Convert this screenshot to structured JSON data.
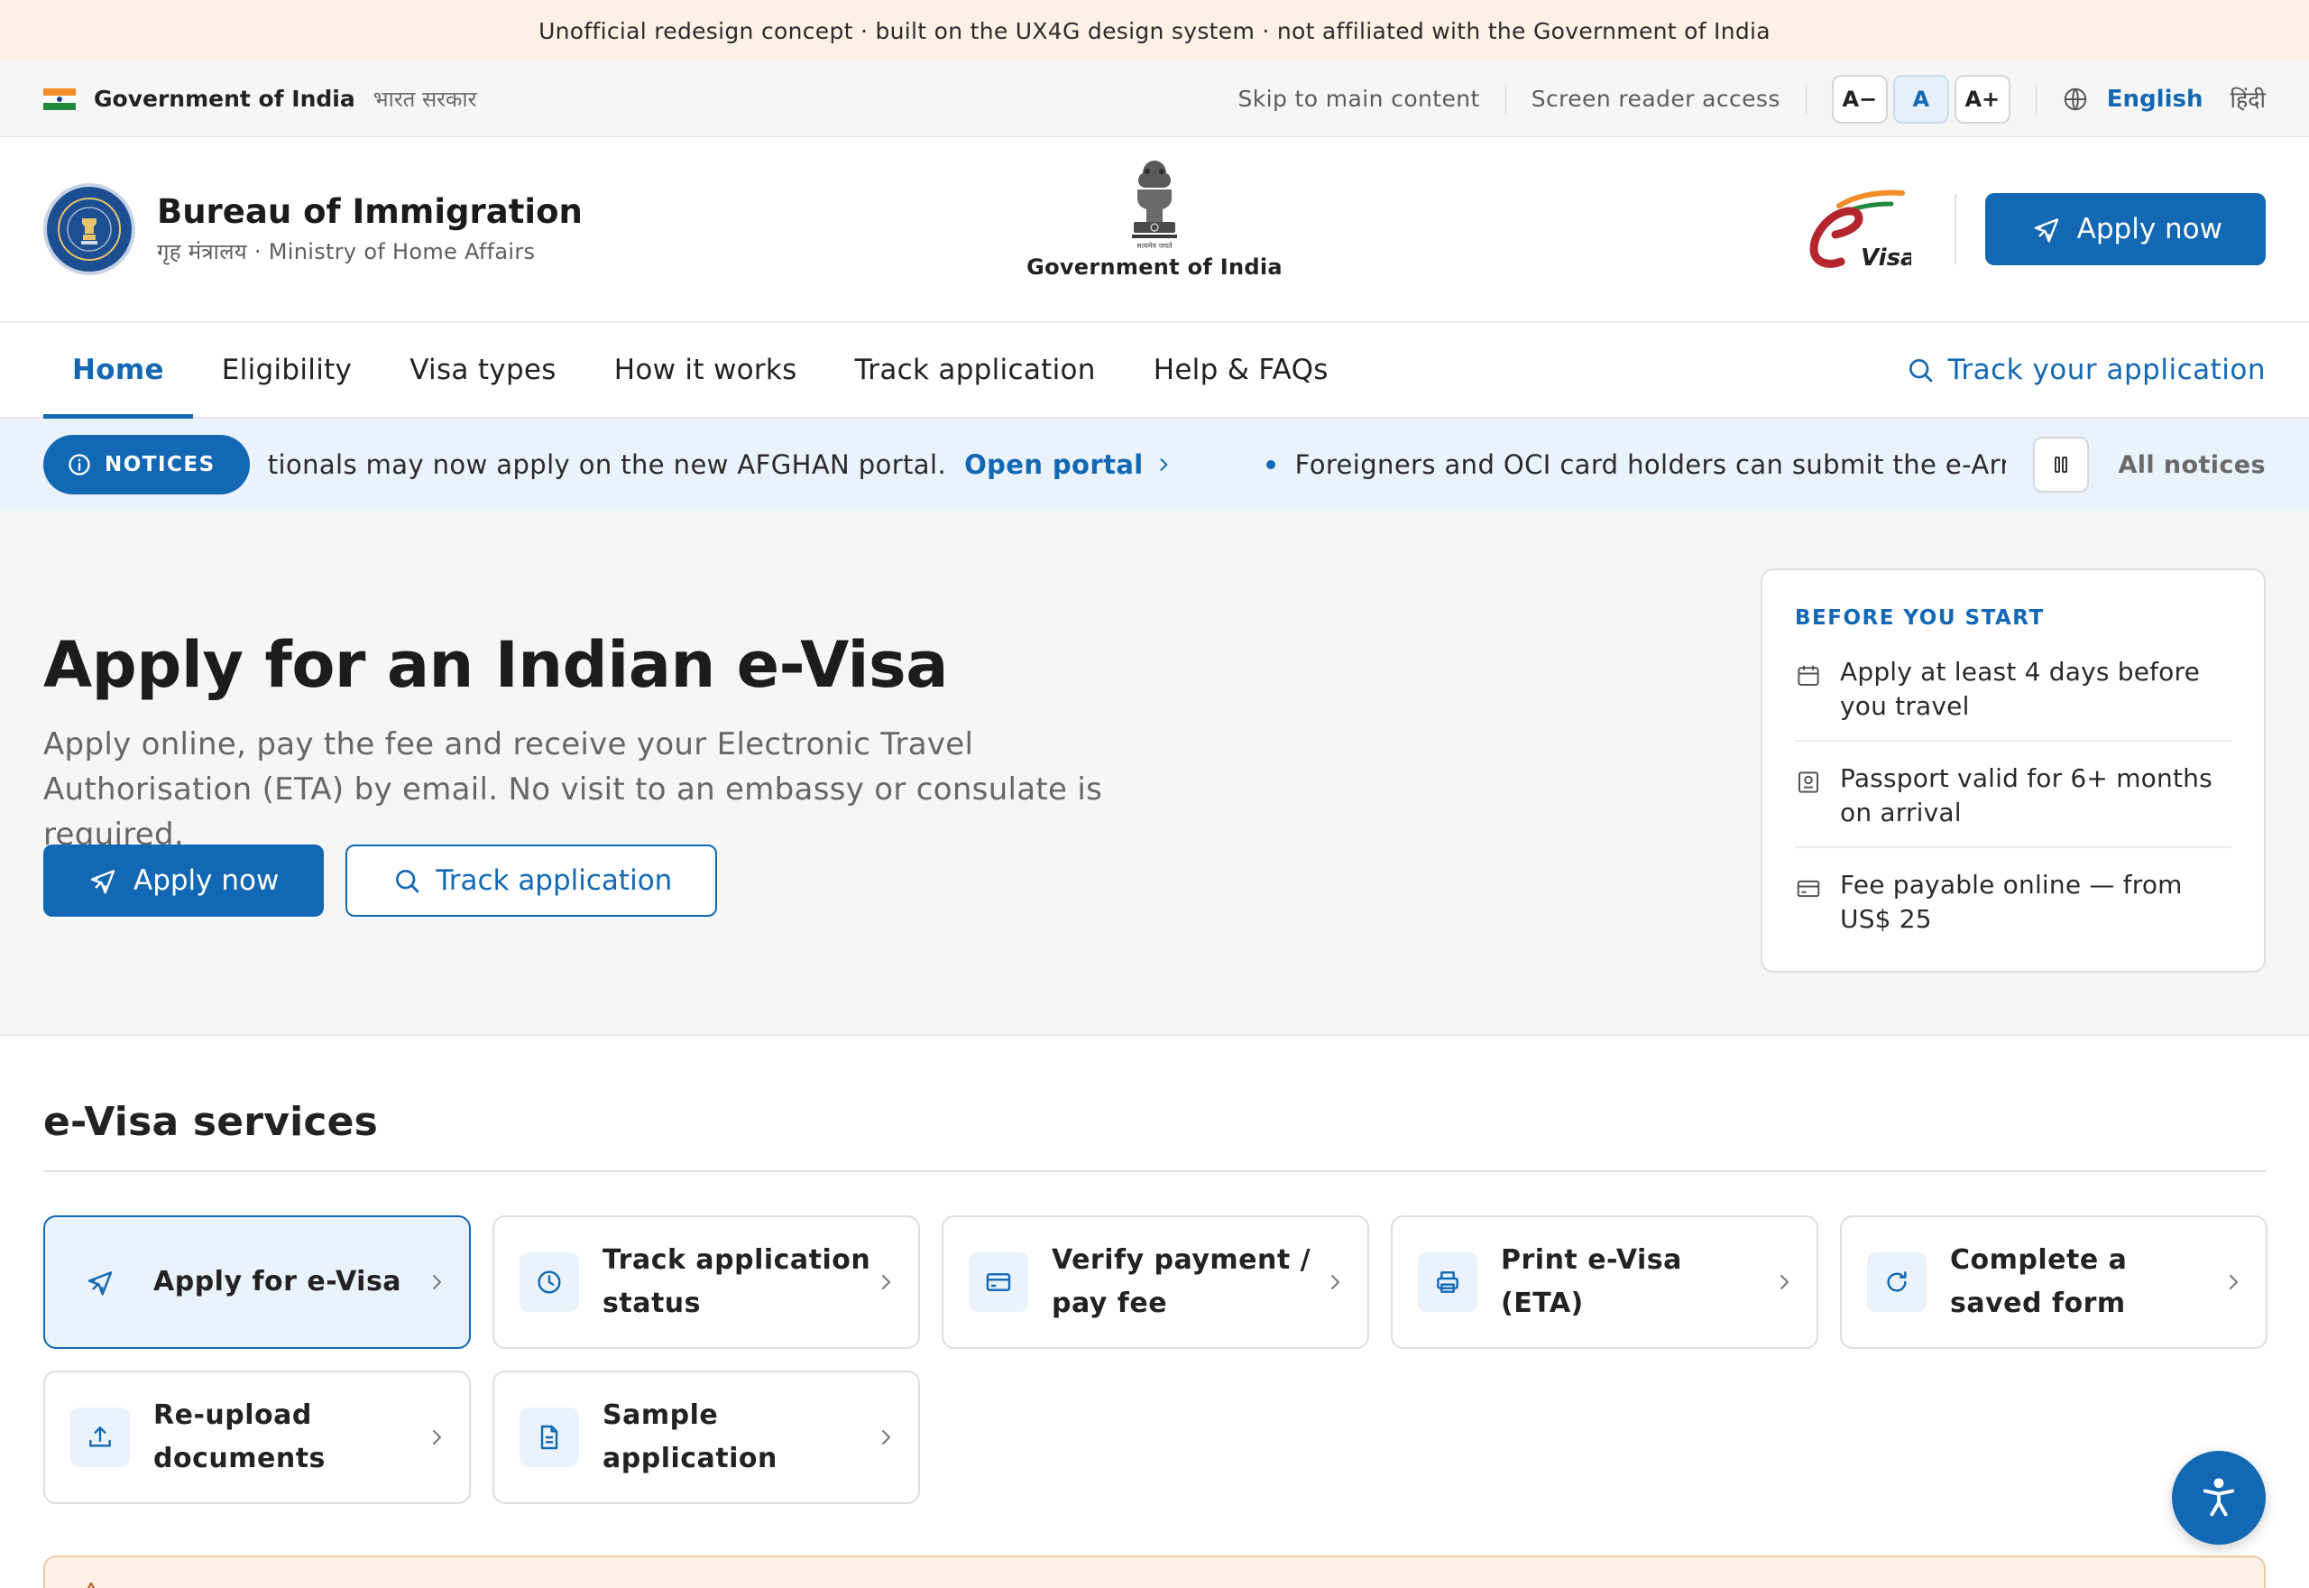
{
  "disclaimer": "Unofficial redesign concept · built on the UX4G design system · not affiliated with the Government of India",
  "utility": {
    "gov_en": "Government of India",
    "gov_hi": "भारत सरकार",
    "skip": "Skip to main content",
    "screen_reader": "Screen reader access",
    "font_small": "A−",
    "font_normal": "A",
    "font_large": "A+",
    "lang_en": "English",
    "lang_hi": "हिंदी",
    "globe_icon": "globe-icon"
  },
  "header": {
    "title": "Bureau of Immigration",
    "subtitle": "गृह मंत्रालय · Ministry of Home Affairs",
    "emblem_caption": "Government of India",
    "emblem_motto": "सत्यमेव जयते",
    "evisa_text": "Visa",
    "apply_label": "Apply now"
  },
  "nav": {
    "items": [
      "Home",
      "Eligibility",
      "Visa types",
      "How it works",
      "Track application",
      "Help & FAQs"
    ],
    "active": "Home",
    "track_label": "Track your application"
  },
  "notices": {
    "label": "NOTICES",
    "item1": "tionals may now apply on the new AFGHAN portal.",
    "item1_link": "Open portal",
    "item2": "Foreigners and OCI card holders can submit the e-Arrival card",
    "all": "All notices"
  },
  "hero": {
    "title": "Apply for an Indian e-Visa",
    "subtitle": "Apply online, pay the fee and receive your Electronic Travel Authorisation (ETA) by email. No visit to an embassy or consulate is required.",
    "apply_label": "Apply now",
    "track_label": "Track application"
  },
  "before": {
    "title": "BEFORE YOU START",
    "items": [
      {
        "icon": "calendar-icon",
        "text": "Apply at least 4 days before you travel"
      },
      {
        "icon": "passport-icon",
        "text": "Passport valid for 6+ months on arrival"
      },
      {
        "icon": "card-icon",
        "text": "Fee payable online — from US$ 25"
      }
    ]
  },
  "services": {
    "title": "e-Visa services",
    "cards": [
      {
        "icon": "plane-icon",
        "label": "Apply for e-Visa"
      },
      {
        "icon": "clock-icon",
        "label": "Track application status"
      },
      {
        "icon": "card-icon",
        "label": "Verify payment / pay fee"
      },
      {
        "icon": "printer-icon",
        "label": "Print e-Visa (ETA)"
      },
      {
        "icon": "refresh-icon",
        "label": "Complete a saved form"
      },
      {
        "icon": "upload-icon",
        "label": "Re-upload documents"
      },
      {
        "icon": "document-icon",
        "label": "Sample application"
      }
    ]
  },
  "colors": {
    "primary": "#1268b3",
    "disclaimer_bg": "#fdf1e6",
    "notice_bg": "#eaf2fb",
    "hero_bg": "#f6f6f6"
  }
}
